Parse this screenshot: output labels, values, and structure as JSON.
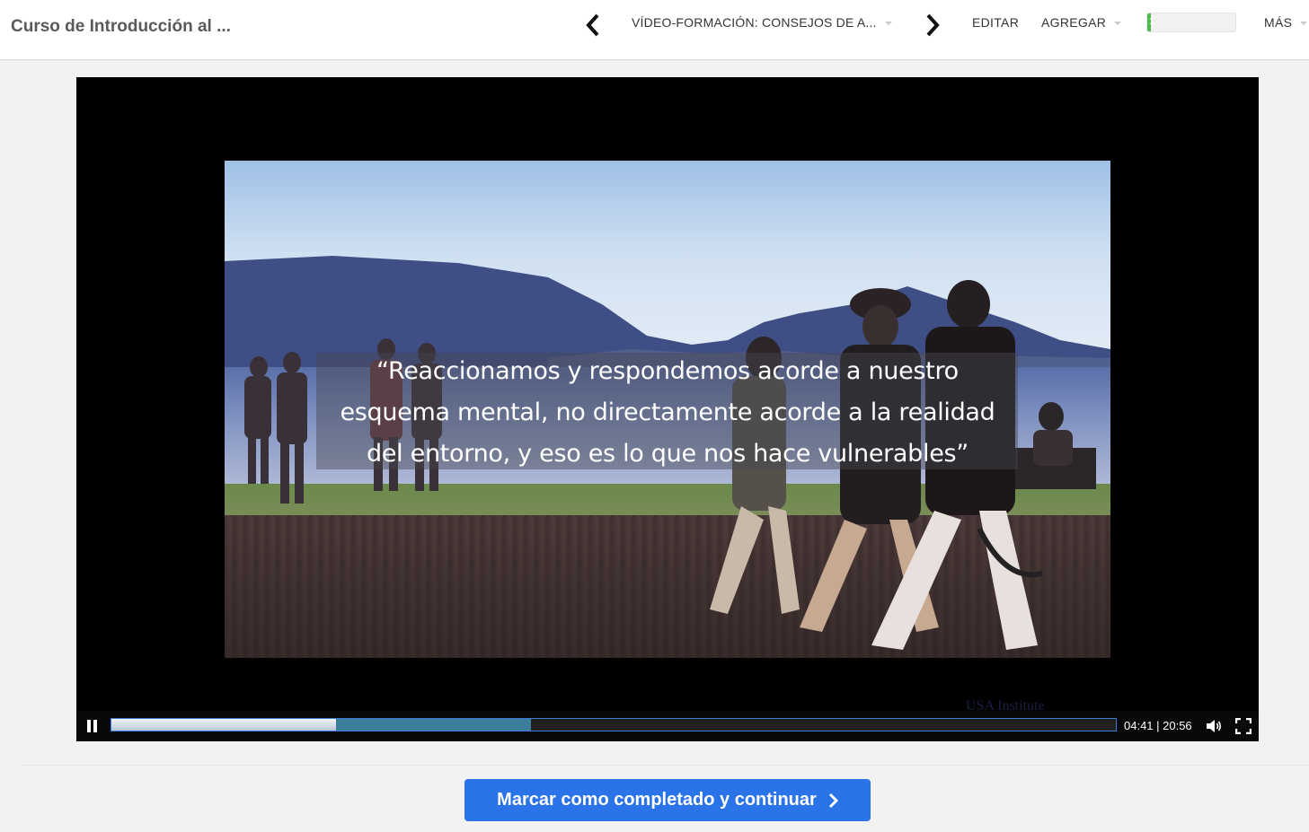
{
  "header": {
    "course_title": "Curso de Introducción al ...",
    "lesson_select": "VÍDEO-FORMACIÓN: CONSEJOS DE A...",
    "edit_label": "EDITAR",
    "add_label": "AGREGAR",
    "more_label": "MÁS",
    "progress_text": "1",
    "progress_percent": 4,
    "accent_color": "#4cbb4e"
  },
  "video": {
    "quote_line1": "“Reaccionamos y respondemos acorde a nuestro",
    "quote_line2": "esquema mental, no directamente acorde a la realidad",
    "quote_line3": "del entorno, y eso es lo que nos hace vulnerables”",
    "watermark": "USA Institute",
    "current_time": "04:41",
    "duration": "20:56",
    "time_display": "04:41 | 20:56",
    "played_fraction": 0.224,
    "buffered_fraction": 0.418
  },
  "footer": {
    "complete_button_label": "Marcar como completado y continuar",
    "button_color": "#2a73e8"
  }
}
